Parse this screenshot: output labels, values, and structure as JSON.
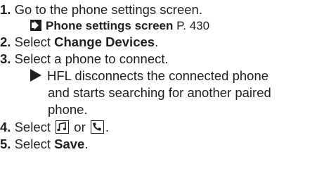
{
  "steps": [
    {
      "number": "1.",
      "text": "Go to the phone settings screen."
    },
    {
      "number": "2.",
      "prefix": "Select ",
      "bold": "Change Devices",
      "suffix": "."
    },
    {
      "number": "3.",
      "text": "Select a phone to connect."
    },
    {
      "number": "4.",
      "prefix": "Select ",
      "middle": " or ",
      "suffix": "."
    },
    {
      "number": "5.",
      "prefix": "Select ",
      "bold": "Save",
      "suffix": "."
    }
  ],
  "reference": {
    "bold": "Phone settings screen",
    "page": " P. 430"
  },
  "note": {
    "line1": "HFL disconnects the connected phone",
    "line2": "and starts searching for another paired",
    "line3": "phone."
  },
  "icons": {
    "reference_arrow": "arrow-right-icon",
    "note_bullet": "triangle-bullet-icon",
    "music": "music-note-icon",
    "phone": "phone-handset-icon"
  }
}
